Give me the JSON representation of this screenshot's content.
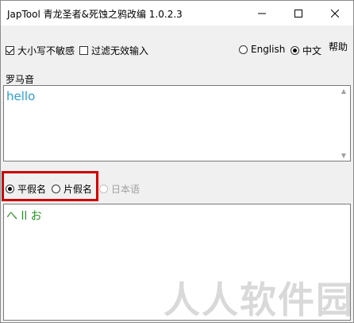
{
  "window": {
    "title": "JapTool 青龙圣者&死蚀之鸦改编 1.0.2.3"
  },
  "options": {
    "case_insensitive_label": "大小写不敏感",
    "case_insensitive_checked": true,
    "filter_invalid_label": "过滤无效输入",
    "filter_invalid_checked": false
  },
  "language": {
    "english_label": "English",
    "chinese_label": "中文",
    "selected": "中文"
  },
  "help_label": "帮助",
  "romaji": {
    "label": "罗马音",
    "value": "hello"
  },
  "output_mode": {
    "hiragana_label": "平假名",
    "katakana_label": "片假名",
    "japanese_label": "日本语",
    "selected": "平假名"
  },
  "output": {
    "value": "へ ll お"
  },
  "watermark": "人人软件园",
  "colors": {
    "romaji_text": "#2e9fd1",
    "output_text": "#2e8b2e",
    "highlight": "#cc0000"
  }
}
